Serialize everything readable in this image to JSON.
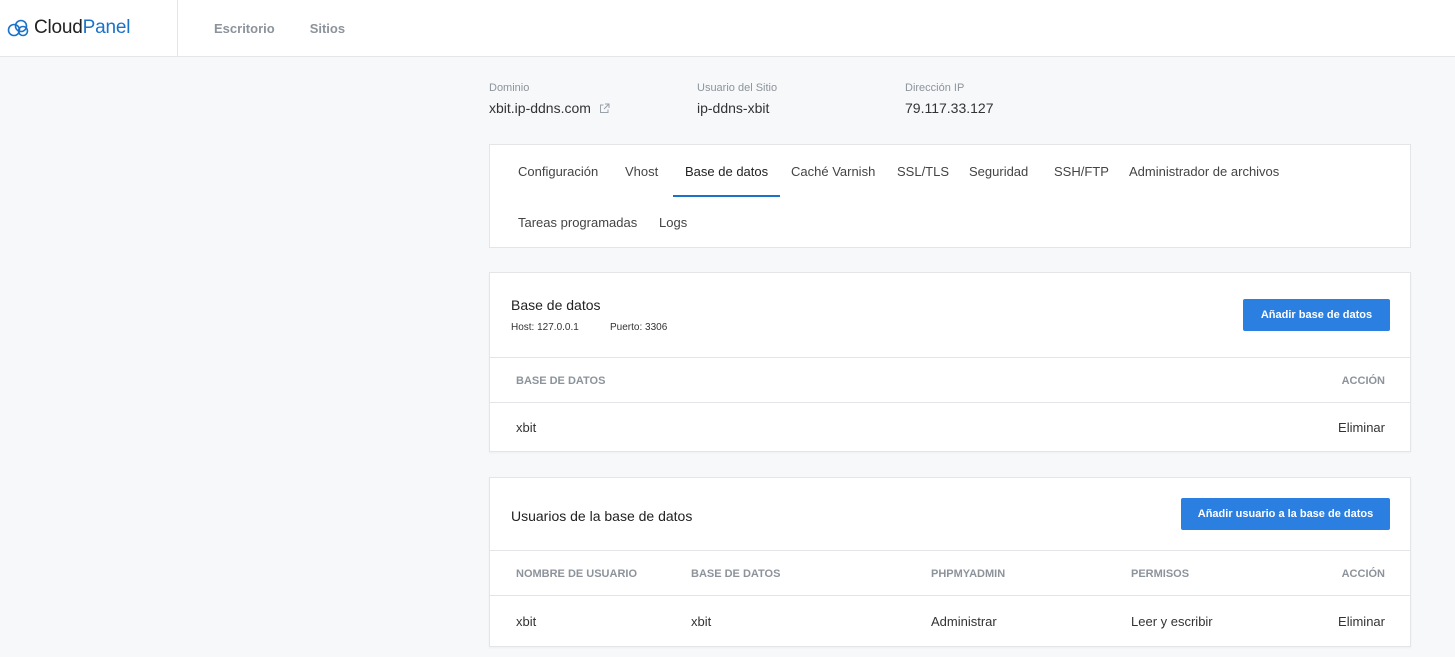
{
  "app": {
    "logo_part1": "Cloud",
    "logo_part2": "Panel",
    "brand_color": "#1a72c9"
  },
  "nav": {
    "items": [
      "Escritorio",
      "Sitios"
    ]
  },
  "site_info": {
    "domain_label": "Dominio",
    "domain_value": "xbit.ip-ddns.com",
    "user_label": "Usuario del Sitio",
    "user_value": "ip-ddns-xbit",
    "ip_label": "Dirección IP",
    "ip_value": "79.117.33.127"
  },
  "tabs": {
    "items": [
      {
        "label": "Configuración"
      },
      {
        "label": "Vhost"
      },
      {
        "label": "Base de datos",
        "active": true
      },
      {
        "label": "Caché Varnish"
      },
      {
        "label": "SSL/TLS"
      },
      {
        "label": "Seguridad"
      },
      {
        "label": "SSH/FTP"
      },
      {
        "label": "Administrador de archivos"
      },
      {
        "label": "Tareas programadas"
      },
      {
        "label": "Logs"
      }
    ]
  },
  "databases": {
    "title": "Base de datos",
    "host_label": "Host:",
    "host_value": "127.0.0.1",
    "port_label": "Puerto:",
    "port_value": "3306",
    "add_button": "Añadir base de datos",
    "columns": [
      "BASE DE DATOS",
      "ACCIÓN"
    ],
    "rows": [
      {
        "name": "xbit",
        "action": "Eliminar"
      }
    ]
  },
  "db_users": {
    "title": "Usuarios de la base de datos",
    "add_button": "Añadir usuario a la base de datos",
    "columns": [
      "NOMBRE DE USUARIO",
      "BASE DE DATOS",
      "PHPMYADMIN",
      "PERMISOS",
      "ACCIÓN"
    ],
    "rows": [
      {
        "user": "xbit",
        "database": "xbit",
        "phpmyadmin": "Administrar",
        "permissions": "Leer y escribir",
        "action": "Eliminar"
      }
    ]
  }
}
